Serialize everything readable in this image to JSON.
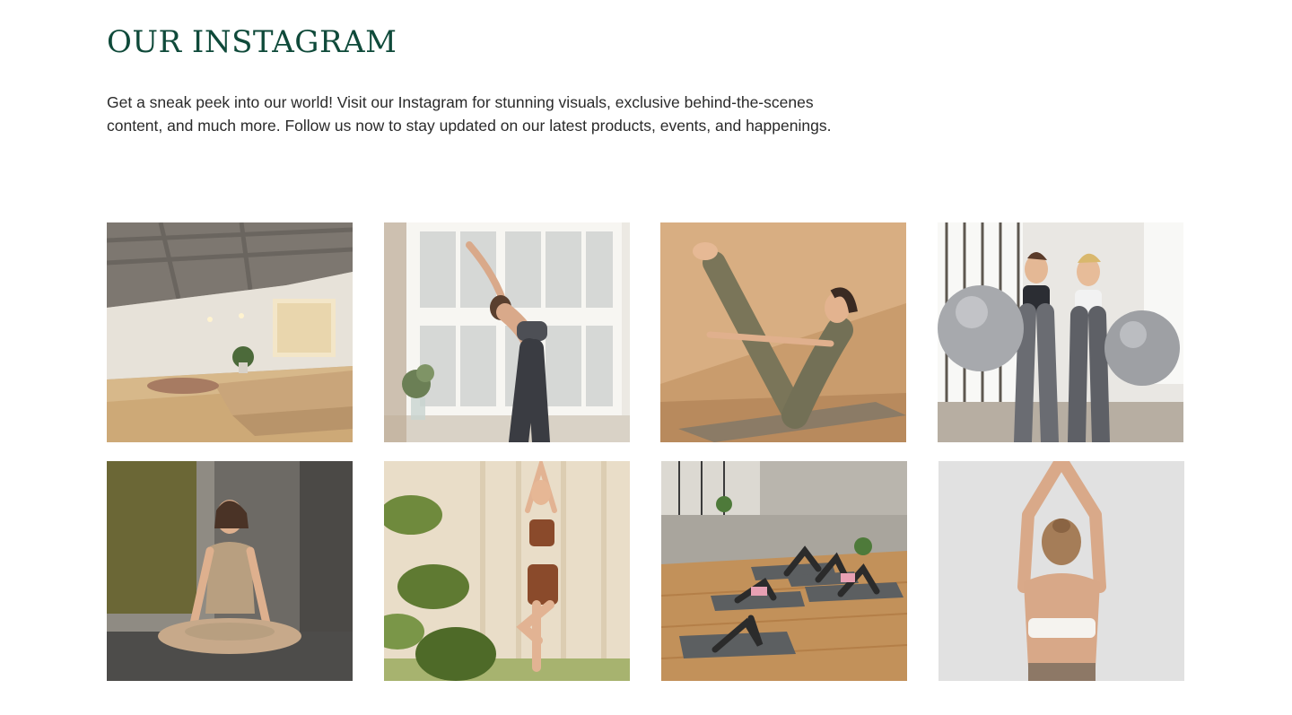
{
  "instagram": {
    "title": "OUR INSTAGRAM",
    "description_line1": "Get a sneak peek into our world! Visit our Instagram for stunning visuals, exclusive behind-the-scenes",
    "description_line2": "content, and much more. Follow us now to stay updated on our latest products, events, and happenings."
  },
  "colors": {
    "title": "#0f4a3a",
    "text": "#2a2a2a",
    "background": "#ffffff"
  },
  "gallery": [
    {
      "subject": "studio-interior"
    },
    {
      "subject": "backbend-by-window"
    },
    {
      "subject": "boat-pose-on-mat"
    },
    {
      "subject": "two-women-with-exercise-balls"
    },
    {
      "subject": "seated-lotus-meditation"
    },
    {
      "subject": "tree-pose-by-curtains"
    },
    {
      "subject": "group-pilates-bridges"
    },
    {
      "subject": "back-view-arms-overhead"
    }
  ]
}
